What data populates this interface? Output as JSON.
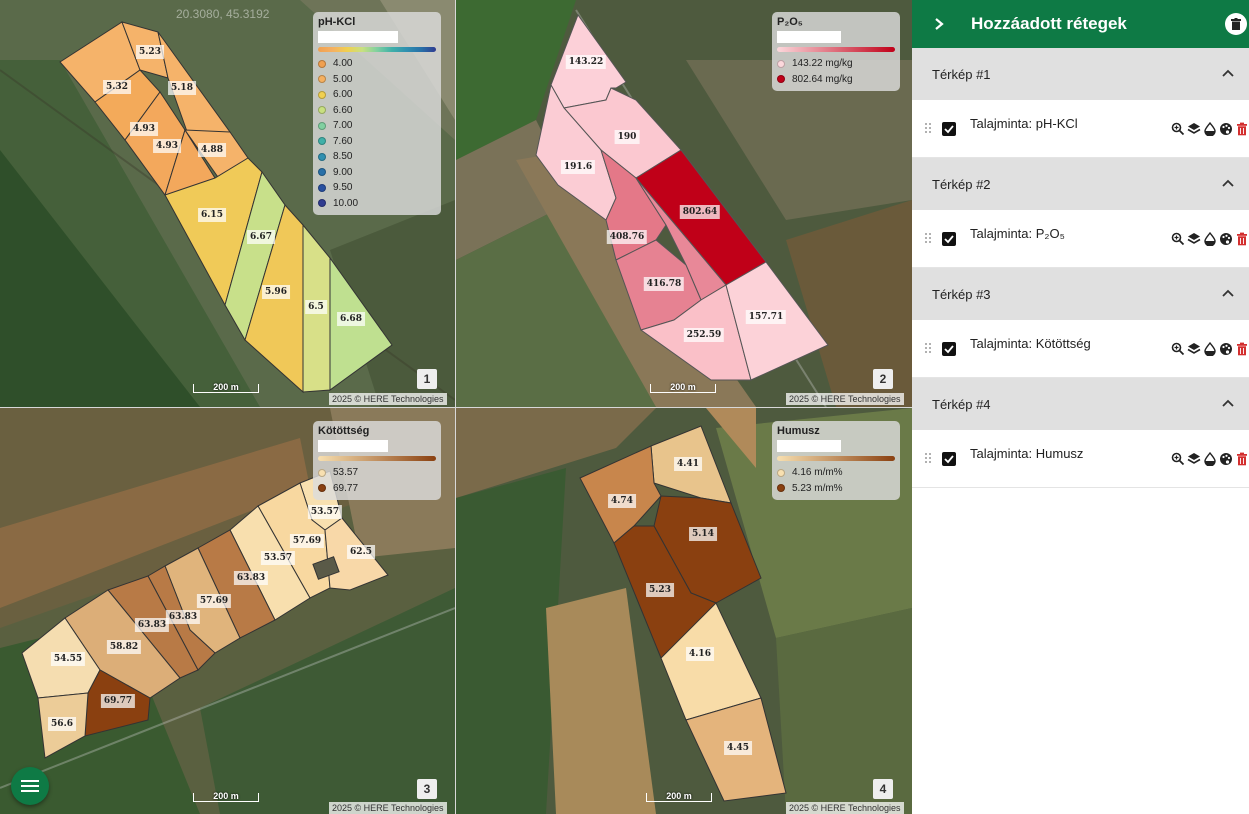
{
  "coords": "20.3080, 45.3192",
  "maps": [
    {
      "legend_title": "pH-KCl",
      "legend_items": [
        {
          "label": "4.00",
          "color": "#f0a050"
        },
        {
          "label": "5.00",
          "color": "#f5b060"
        },
        {
          "label": "6.00",
          "color": "#f0d050"
        },
        {
          "label": "6.60",
          "color": "#c8e080"
        },
        {
          "label": "7.00",
          "color": "#80d0a0"
        },
        {
          "label": "7.60",
          "color": "#40b0a8"
        },
        {
          "label": "8.50",
          "color": "#3090b0"
        },
        {
          "label": "9.00",
          "color": "#2870a8"
        },
        {
          "label": "9.50",
          "color": "#2850a0"
        },
        {
          "label": "10.00",
          "color": "#303c90"
        }
      ],
      "values": [
        "5.23",
        "5.32",
        "5.18",
        "4.93",
        "4.93",
        "4.88",
        "6.15",
        "6.67",
        "5.96",
        "6.5",
        "6.68"
      ],
      "scale": "200 m",
      "attribution": "2025 © HERE Technologies",
      "number": "1"
    },
    {
      "legend_title": "P₂O₅",
      "legend_items": [
        {
          "label": "143.22 mg/kg",
          "color": "#fcd8dc"
        },
        {
          "label": "802.64 mg/kg",
          "color": "#c00018"
        }
      ],
      "values": [
        "143.22",
        "190",
        "191.6",
        "802.64",
        "408.76",
        "416.78",
        "252.59",
        "157.71"
      ],
      "scale": "200 m",
      "attribution": "2025 © HERE Technologies",
      "number": "2"
    },
    {
      "legend_title": "Kötöttség",
      "legend_items": [
        {
          "label": "53.57",
          "color": "#f8e0b0"
        },
        {
          "label": "69.77",
          "color": "#8a4010"
        }
      ],
      "values": [
        "53.57",
        "57.69",
        "62.5",
        "53.57",
        "63.83",
        "57.69",
        "63.83",
        "63.83",
        "58.82",
        "54.55",
        "69.77",
        "56.6"
      ],
      "scale": "200 m",
      "attribution": "2025 © HERE Technologies",
      "number": "3"
    },
    {
      "legend_title": "Humusz",
      "legend_items": [
        {
          "label": "4.16 m/m%",
          "color": "#f8e0b0"
        },
        {
          "label": "5.23 m/m%",
          "color": "#8a4010"
        }
      ],
      "values": [
        "4.41",
        "4.74",
        "5.14",
        "5.23",
        "4.16",
        "4.45"
      ],
      "scale": "200 m",
      "attribution": "2025 © HERE Technologies",
      "number": "4"
    }
  ],
  "panel": {
    "title": "Hozzáadott rétegek",
    "sections": [
      {
        "title": "Térkép #1",
        "layer": "Talajminta: pH-KCl"
      },
      {
        "title": "Térkép #2",
        "layer": "Talajminta: P₂O₅"
      },
      {
        "title": "Térkép #3",
        "layer": "Talajminta: Kötöttség"
      },
      {
        "title": "Térkép #4",
        "layer": "Talajminta: Humusz"
      }
    ]
  },
  "colors": {
    "brand": "#0e7a45",
    "delete": "#d32f2f"
  }
}
